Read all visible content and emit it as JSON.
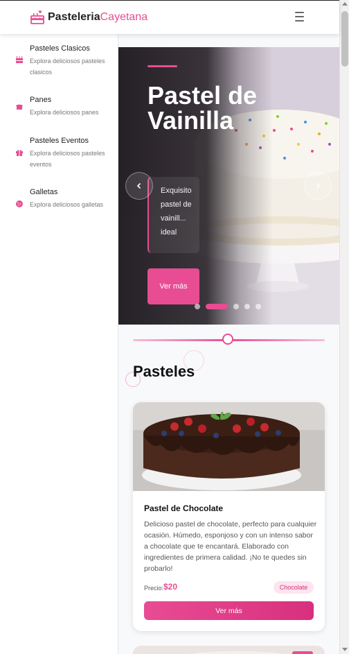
{
  "header": {
    "brand_strong": "Pasteleria",
    "brand_light": "Cayetana",
    "logo_icon": "cake-icon",
    "menu_icon": "hamburger-icon"
  },
  "sidebar": {
    "items": [
      {
        "label": "Pasteles Clasicos",
        "desc": "Explora deliciosos pasteles clasicos",
        "icon": "cake-icon"
      },
      {
        "label": "Panes",
        "desc": "Explora deliciosos panes",
        "icon": "bread-icon"
      },
      {
        "label": "Pasteles Eventos",
        "desc": "Explora deliciosos pasteles eventos",
        "icon": "gift-icon"
      },
      {
        "label": "Galletas",
        "desc": "Explora deliciosos galletas",
        "icon": "cookie-icon"
      }
    ]
  },
  "hero": {
    "title": "Pastel de Vainilla",
    "desc": "Exquisito pastel de vainill... ideal",
    "button_label": "Ver más",
    "slides": 5,
    "active_slide": 2,
    "prev_icon": "chevron-left-icon",
    "next_icon": "chevron-right-icon"
  },
  "section": {
    "title": "Pasteles"
  },
  "card": {
    "title": "Pastel de Chocolate",
    "desc": "Delicioso pastel de chocolate, perfecto para cualquier ocasión. Húmedo, esponjoso y con un intenso sabor a chocolate que te encantará. Elaborado con ingredientes de primera calidad. ¡No te quedes sin probarlo!",
    "price_label": "Precio:",
    "price_value": "$20",
    "badge": "Chocolate",
    "button_label": "Ver más"
  },
  "colors": {
    "accent": "#e84c93",
    "badge_bg": "#fde4ef"
  }
}
